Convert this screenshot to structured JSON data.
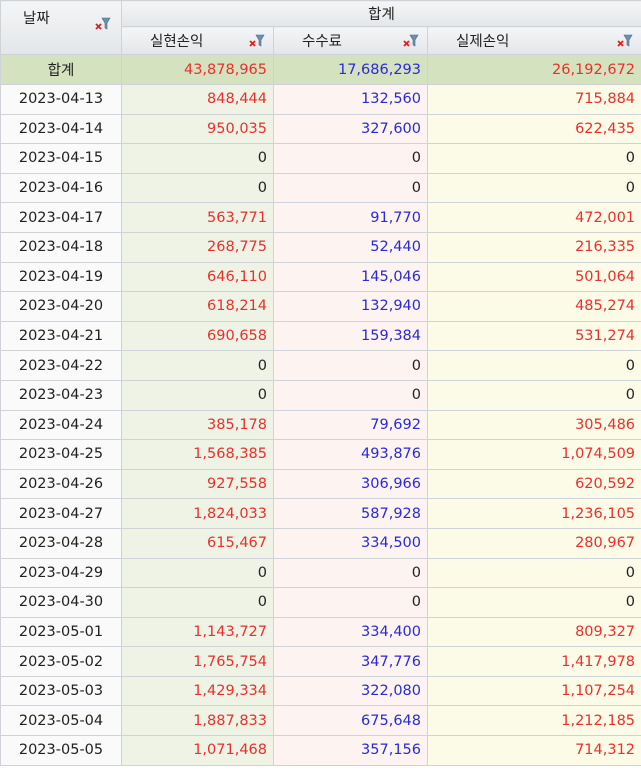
{
  "header": {
    "date_label": "날짜",
    "group_label": "합계",
    "col1_label": "실현손익",
    "col2_label": "수수료",
    "col3_label": "실제손익",
    "filter_icon": "filter-clear-icon"
  },
  "total_row": {
    "label": "합계",
    "realized": "43,878,965",
    "fee": "17,686,293",
    "actual": "26,192,672"
  },
  "rows": [
    {
      "date": "2023-04-13",
      "realized": "848,444",
      "fee": "132,560",
      "actual": "715,884"
    },
    {
      "date": "2023-04-14",
      "realized": "950,035",
      "fee": "327,600",
      "actual": "622,435"
    },
    {
      "date": "2023-04-15",
      "realized": "0",
      "fee": "0",
      "actual": "0"
    },
    {
      "date": "2023-04-16",
      "realized": "0",
      "fee": "0",
      "actual": "0"
    },
    {
      "date": "2023-04-17",
      "realized": "563,771",
      "fee": "91,770",
      "actual": "472,001"
    },
    {
      "date": "2023-04-18",
      "realized": "268,775",
      "fee": "52,440",
      "actual": "216,335"
    },
    {
      "date": "2023-04-19",
      "realized": "646,110",
      "fee": "145,046",
      "actual": "501,064"
    },
    {
      "date": "2023-04-20",
      "realized": "618,214",
      "fee": "132,940",
      "actual": "485,274"
    },
    {
      "date": "2023-04-21",
      "realized": "690,658",
      "fee": "159,384",
      "actual": "531,274"
    },
    {
      "date": "2023-04-22",
      "realized": "0",
      "fee": "0",
      "actual": "0"
    },
    {
      "date": "2023-04-23",
      "realized": "0",
      "fee": "0",
      "actual": "0"
    },
    {
      "date": "2023-04-24",
      "realized": "385,178",
      "fee": "79,692",
      "actual": "305,486"
    },
    {
      "date": "2023-04-25",
      "realized": "1,568,385",
      "fee": "493,876",
      "actual": "1,074,509"
    },
    {
      "date": "2023-04-26",
      "realized": "927,558",
      "fee": "306,966",
      "actual": "620,592"
    },
    {
      "date": "2023-04-27",
      "realized": "1,824,033",
      "fee": "587,928",
      "actual": "1,236,105"
    },
    {
      "date": "2023-04-28",
      "realized": "615,467",
      "fee": "334,500",
      "actual": "280,967"
    },
    {
      "date": "2023-04-29",
      "realized": "0",
      "fee": "0",
      "actual": "0"
    },
    {
      "date": "2023-04-30",
      "realized": "0",
      "fee": "0",
      "actual": "0"
    },
    {
      "date": "2023-05-01",
      "realized": "1,143,727",
      "fee": "334,400",
      "actual": "809,327"
    },
    {
      "date": "2023-05-02",
      "realized": "1,765,754",
      "fee": "347,776",
      "actual": "1,417,978"
    },
    {
      "date": "2023-05-03",
      "realized": "1,429,334",
      "fee": "322,080",
      "actual": "1,107,254"
    },
    {
      "date": "2023-05-04",
      "realized": "1,887,833",
      "fee": "675,648",
      "actual": "1,212,185"
    },
    {
      "date": "2023-05-05",
      "realized": "1,071,468",
      "fee": "357,156",
      "actual": "714,312"
    }
  ],
  "colors": {
    "positive": "#e8312c",
    "fee": "#2a2ad6",
    "zero": "#222222",
    "total_bg": "#d4e2bf"
  }
}
